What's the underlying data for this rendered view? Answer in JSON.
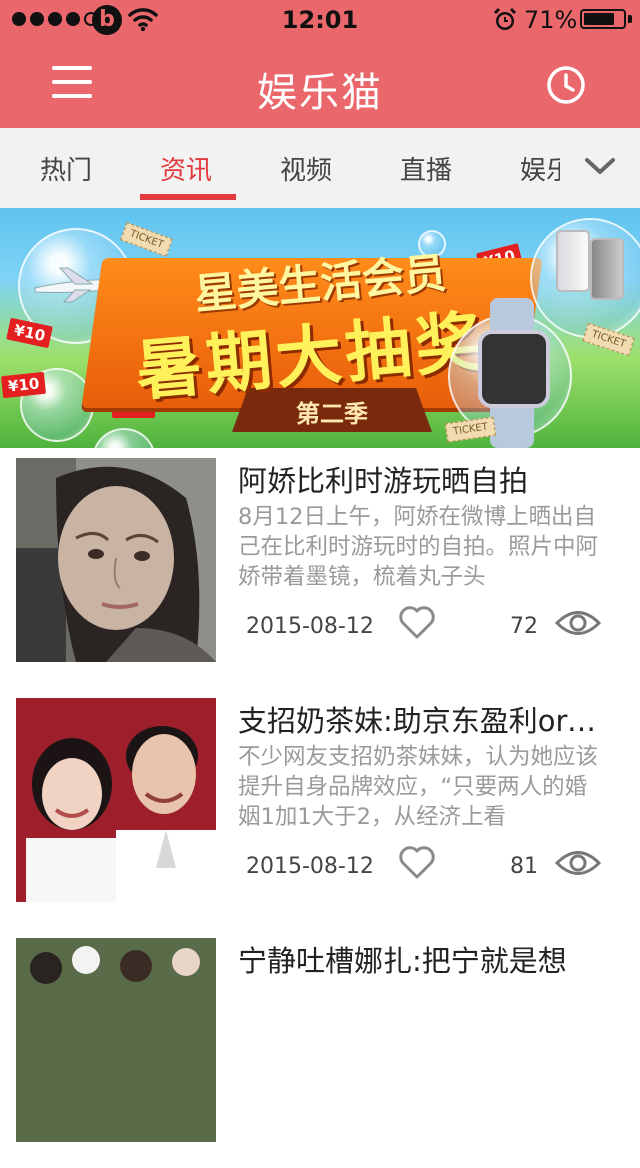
{
  "status_bar": {
    "time": "12:01",
    "battery": "71%",
    "signal_dots": 5,
    "signal_filled": 4,
    "icons": [
      "beats-icon",
      "wifi-icon",
      "alarm-icon",
      "battery-icon"
    ]
  },
  "header": {
    "title": "娱乐猫",
    "icons": [
      "menu-icon",
      "history-clock-icon"
    ]
  },
  "tabs": {
    "items": [
      {
        "label": "热门",
        "active": false
      },
      {
        "label": "资讯",
        "active": true
      },
      {
        "label": "视频",
        "active": false
      },
      {
        "label": "直播",
        "active": false
      },
      {
        "label": "娱乐",
        "active": false
      }
    ],
    "more_icon": "chevron-down-icon"
  },
  "banner": {
    "line1": "星美生活会员",
    "line2": "暑期大抽奖",
    "season": "第二季",
    "price_tag": "¥10",
    "ticket_text": "TICKET"
  },
  "articles": [
    {
      "title": "阿娇比利时游玩晒自拍",
      "summary": "8月12日上午，阿娇在微博上晒出自己在比利时游玩时的自拍。照片中阿娇带着墨镜，梳着丸子头",
      "date": "2015-08-12",
      "views": "72"
    },
    {
      "title": "支招奶茶妹:助京东盈利ordering",
      "summary": "不少网友支招奶茶妹妹，认为她应该提升自身品牌效应，“只要两人的婚姻1加1大于2，从经济上看",
      "date": "2015-08-12",
      "views": "81"
    },
    {
      "title": "宁静吐槽娜扎:把宁就是想",
      "summary": "",
      "date": "",
      "views": ""
    }
  ],
  "colors": {
    "brand": "#ea676b",
    "tab_active": "#e23a3f",
    "summary_text": "#9a9a9a"
  }
}
